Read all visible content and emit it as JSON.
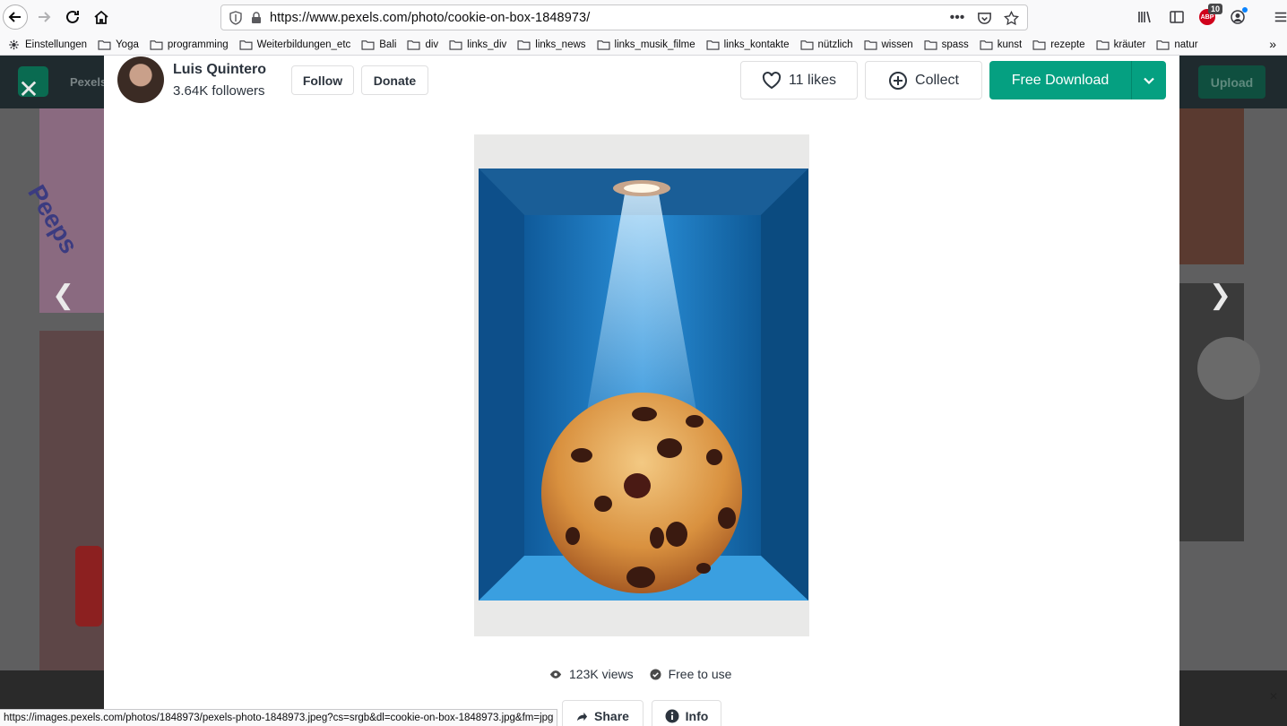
{
  "browser": {
    "url": "https://www.pexels.com/photo/cookie-on-box-1848973/",
    "abp_count": "10",
    "abp_label": "ABP",
    "bookmarks": [
      {
        "label": "Einstellungen",
        "icon": "gear-icon"
      },
      {
        "label": "Yoga",
        "icon": "folder-icon"
      },
      {
        "label": "programming",
        "icon": "folder-icon"
      },
      {
        "label": "Weiterbildungen_etc",
        "icon": "folder-icon"
      },
      {
        "label": "Bali",
        "icon": "folder-icon"
      },
      {
        "label": "div",
        "icon": "folder-icon"
      },
      {
        "label": "links_div",
        "icon": "folder-icon"
      },
      {
        "label": "links_news",
        "icon": "folder-icon"
      },
      {
        "label": "links_musik_filme",
        "icon": "folder-icon"
      },
      {
        "label": "links_kontakte",
        "icon": "folder-icon"
      },
      {
        "label": "nützlich",
        "icon": "folder-icon"
      },
      {
        "label": "wissen",
        "icon": "folder-icon"
      },
      {
        "label": "spass",
        "icon": "folder-icon"
      },
      {
        "label": "kunst",
        "icon": "folder-icon"
      },
      {
        "label": "rezepte",
        "icon": "folder-icon"
      },
      {
        "label": "kräuter",
        "icon": "folder-icon"
      },
      {
        "label": "natur",
        "icon": "folder-icon"
      }
    ],
    "status_url": "https://images.pexels.com/photos/1848973/pexels-photo-1848973.jpeg?cs=srgb&dl=cookie-on-box-1848973.jpg&fm=jpg"
  },
  "background": {
    "brand": "Pexels",
    "upload_label": "Upload",
    "thumb_text": "Peeps"
  },
  "modal": {
    "author_name": "Luis Quintero",
    "followers": "3.64K followers",
    "follow_label": "Follow",
    "donate_label": "Donate",
    "likes_label": "11 likes",
    "collect_label": "Collect",
    "download_label": "Free Download",
    "views": "123K views",
    "license": "Free to use",
    "share_label": "Share",
    "info_label": "Info"
  },
  "colors": {
    "accent": "#05a081",
    "photo_box": "#1f73b8"
  }
}
